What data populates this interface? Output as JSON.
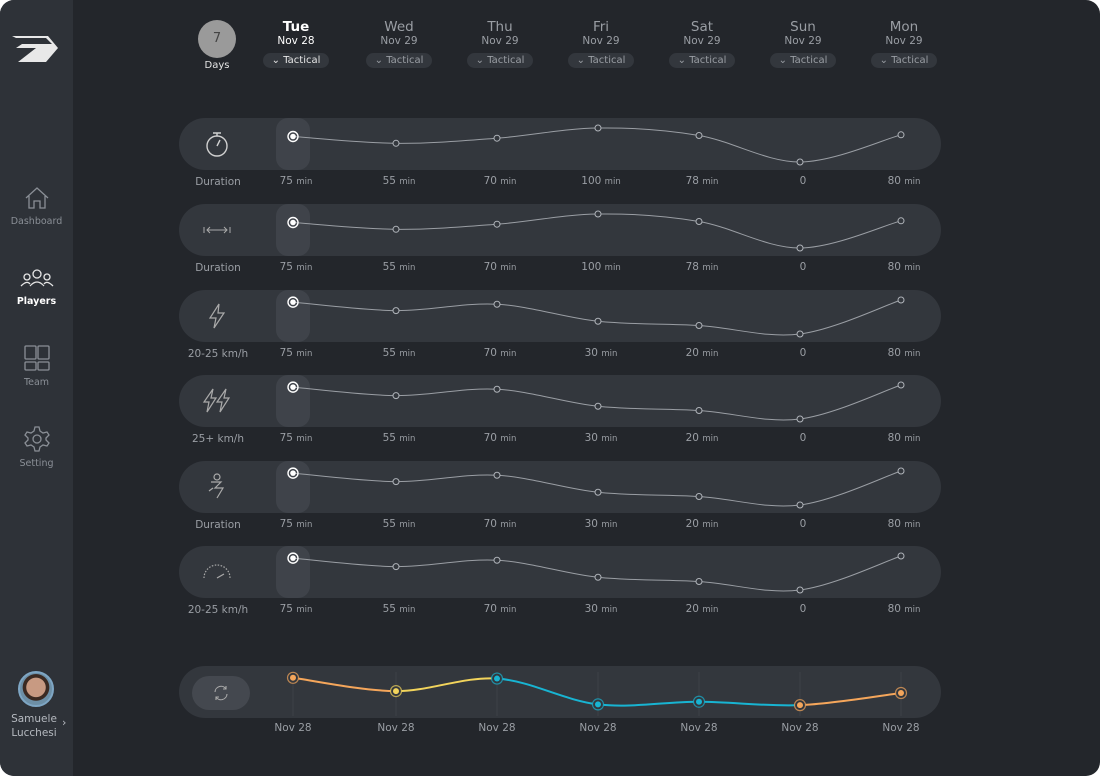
{
  "sidebar": {
    "items": [
      {
        "label": "Dashboard",
        "icon": "home-icon"
      },
      {
        "label": "Players",
        "icon": "players-icon",
        "active": true
      },
      {
        "label": "Team",
        "icon": "grid-icon"
      },
      {
        "label": "Setting",
        "icon": "gear-icon"
      }
    ],
    "user": {
      "first": "Samuele",
      "last": "Lucchesi"
    }
  },
  "range": {
    "count": "7",
    "label": "Days"
  },
  "days": [
    {
      "name": "Tue",
      "date": "Nov 28",
      "type": "Tactical",
      "active": true
    },
    {
      "name": "Wed",
      "date": "Nov 29",
      "type": "Tactical"
    },
    {
      "name": "Thu",
      "date": "Nov 29",
      "type": "Tactical"
    },
    {
      "name": "Fri",
      "date": "Nov 29",
      "type": "Tactical"
    },
    {
      "name": "Sat",
      "date": "Nov 29",
      "type": "Tactical"
    },
    {
      "name": "Sun",
      "date": "Nov 29",
      "type": "Tactical"
    },
    {
      "name": "Mon",
      "date": "Nov 29",
      "type": "Tactical"
    }
  ],
  "chart_data": [
    {
      "type": "line",
      "label": "Duration",
      "icon": "stopwatch-icon",
      "unit": "min",
      "values": [
        75,
        55,
        70,
        100,
        78,
        0,
        80
      ]
    },
    {
      "type": "line",
      "label": "Duration",
      "icon": "distance-icon",
      "unit": "min",
      "values": [
        75,
        55,
        70,
        100,
        78,
        0,
        80
      ]
    },
    {
      "type": "line",
      "label": "20-25 km/h",
      "icon": "lightning-icon",
      "unit": "min",
      "values": [
        75,
        55,
        70,
        30,
        20,
        0,
        80
      ]
    },
    {
      "type": "line",
      "label": "25+ km/h",
      "icon": "double-lightning-icon",
      "unit": "min",
      "values": [
        75,
        55,
        70,
        30,
        20,
        0,
        80
      ]
    },
    {
      "type": "line",
      "label": "Duration",
      "icon": "sprint-icon",
      "unit": "min",
      "values": [
        75,
        55,
        70,
        30,
        20,
        0,
        80
      ]
    },
    {
      "type": "line",
      "label": "20-25 km/h",
      "icon": "speedometer-icon",
      "unit": "min",
      "values": [
        75,
        55,
        70,
        30,
        20,
        0,
        80
      ]
    },
    {
      "type": "line",
      "label": "",
      "icon": "refresh-icon",
      "categories": [
        "Nov 28",
        "Nov 28",
        "Nov 28",
        "Nov 28",
        "Nov 28",
        "Nov 28",
        "Nov 28"
      ],
      "values": [
        90,
        55,
        88,
        20,
        27,
        18,
        50
      ],
      "point_colors": [
        "#f5a65b",
        "#f2d45c",
        "#18b4d2",
        "#18b4d2",
        "#18b4d2",
        "#f5a65b",
        "#f5a65b"
      ],
      "segment_colors": [
        "#f5a65b",
        "#f2d45c",
        "#18b4d2",
        "#18b4d2",
        "#18b4d2",
        "#f5a65b"
      ]
    }
  ]
}
